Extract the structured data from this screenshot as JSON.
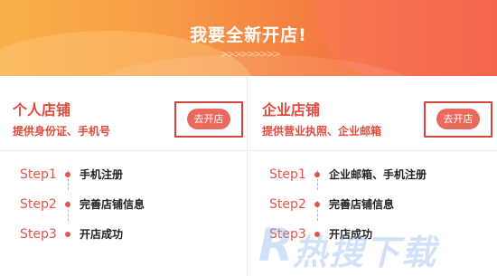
{
  "banner": {
    "title": "我要全新开店!",
    "chevrons": ">>>>>>>>>"
  },
  "personal": {
    "title": "个人店铺",
    "subtitle": "提供身份证、手机号",
    "open_button": "去开店",
    "steps": [
      {
        "label": "Step1",
        "text": "手机注册"
      },
      {
        "label": "Step2",
        "text": "完善店铺信息"
      },
      {
        "label": "Step3",
        "text": "开店成功"
      }
    ]
  },
  "enterprise": {
    "title": "企业店铺",
    "subtitle": "提供营业执照、企业邮箱",
    "open_button": "去开店",
    "steps": [
      {
        "label": "Step1",
        "text": "企业邮箱、手机注册"
      },
      {
        "label": "Step2",
        "text": "完善店铺信息"
      },
      {
        "label": "Step3",
        "text": "开店成功"
      }
    ]
  },
  "watermark": {
    "mark": "R",
    "text": "热搜下载"
  },
  "colors": {
    "accent": "#e14a3c",
    "button": "#e96a5c",
    "banner_start": "#f9b14a",
    "banner_end": "#ef5b3d"
  }
}
